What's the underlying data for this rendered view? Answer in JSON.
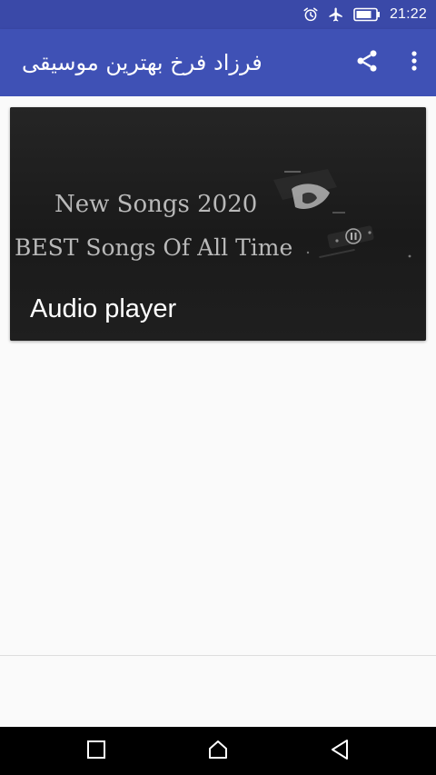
{
  "status_bar": {
    "time": "21:22",
    "icons": [
      "alarm-icon",
      "airplane-mode-icon",
      "battery-icon"
    ]
  },
  "app_bar": {
    "title": "فرزاد فرخ بهترین موسیقی",
    "actions": [
      "share-icon",
      "more-vert-icon"
    ]
  },
  "card": {
    "thumbnail": {
      "line1": "New Songs 2020",
      "line2": "BEST Songs Of All Time"
    },
    "caption": "Audio player"
  },
  "navigation": {
    "buttons": [
      "recent-apps-icon",
      "home-icon",
      "back-icon"
    ]
  },
  "colors": {
    "status_bar": "#3a49a8",
    "app_bar": "#3f51b5",
    "card_bg": "#1b1b1b",
    "nav_bar": "#000000"
  }
}
